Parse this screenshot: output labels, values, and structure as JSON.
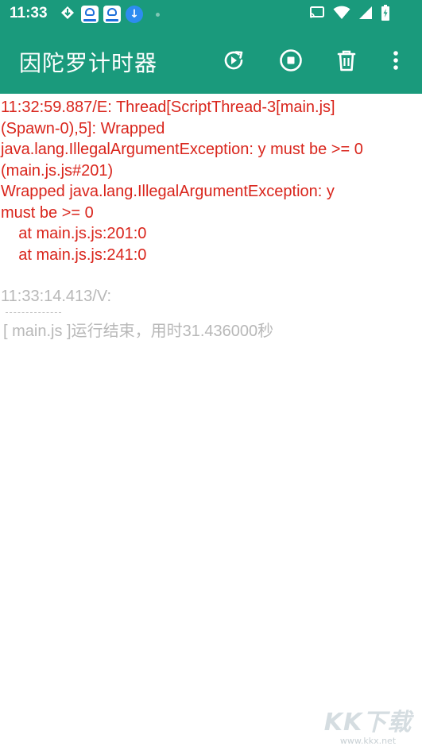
{
  "status_bar": {
    "time": "11:33",
    "icons_left": [
      "navigation-arrow-icon",
      "app-icon",
      "app-icon",
      "download-icon",
      "dot-icon"
    ],
    "icons_right": [
      "cast-icon",
      "wifi-icon",
      "signal-icon",
      "battery-icon"
    ]
  },
  "toolbar": {
    "title": "因陀罗计时器",
    "actions": [
      "rerun-icon",
      "stop-icon",
      "delete-icon",
      "more-vert-icon"
    ],
    "background": "#1a9a7c"
  },
  "console": {
    "error_color": "#d9251c",
    "verbose_color": "#b8b8b8",
    "error_block": {
      "lines": [
        "11:32:59.887/E: Thread[ScriptThread-3[main.js]",
        "(Spawn-0),5]: Wrapped",
        "java.lang.IllegalArgumentException: y must be >= 0",
        "(main.js.js#201)",
        "Wrapped java.lang.IllegalArgumentException: y",
        "must be >= 0",
        "    at main.js.js:201:0",
        "    at main.js.js:241:0"
      ]
    },
    "verbose_block": {
      "header": "11:33:14.413/V:",
      "separator": "------------",
      "message": "[ main.js ]运行结束，用时31.436000秒"
    }
  },
  "watermark": {
    "logo": "KK下载",
    "url": "www.kkx.net"
  }
}
